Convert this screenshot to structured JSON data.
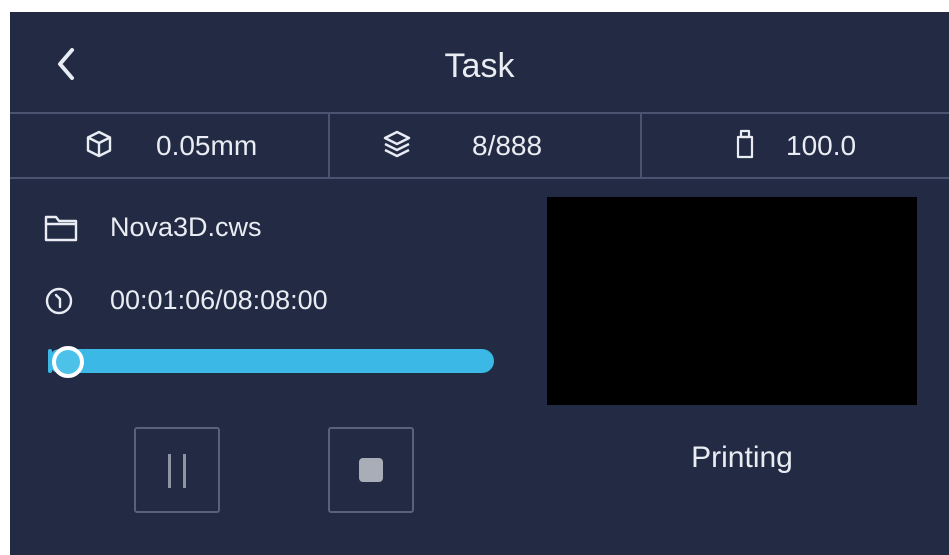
{
  "header": {
    "title": "Task",
    "back_icon": "chevron-left-icon"
  },
  "stats": {
    "layer_height": {
      "icon": "cube-icon",
      "value": "0.05mm"
    },
    "layers": {
      "icon": "layers-icon",
      "value": "8/888"
    },
    "light": {
      "icon": "usb-icon",
      "value": "100.0"
    }
  },
  "file": {
    "icon": "folder-icon",
    "name": "Nova3D.cws"
  },
  "time": {
    "icon": "clock-icon",
    "value": "00:01:06/08:08:00"
  },
  "progress": {
    "fraction": 0.009
  },
  "controls": {
    "pause_icon": "pause-icon",
    "stop_icon": "stop-icon"
  },
  "status": "Printing",
  "colors": {
    "background": "#222b43",
    "divider": "#4a5370",
    "accent": "#3bb8e6",
    "preview": "#000000"
  }
}
